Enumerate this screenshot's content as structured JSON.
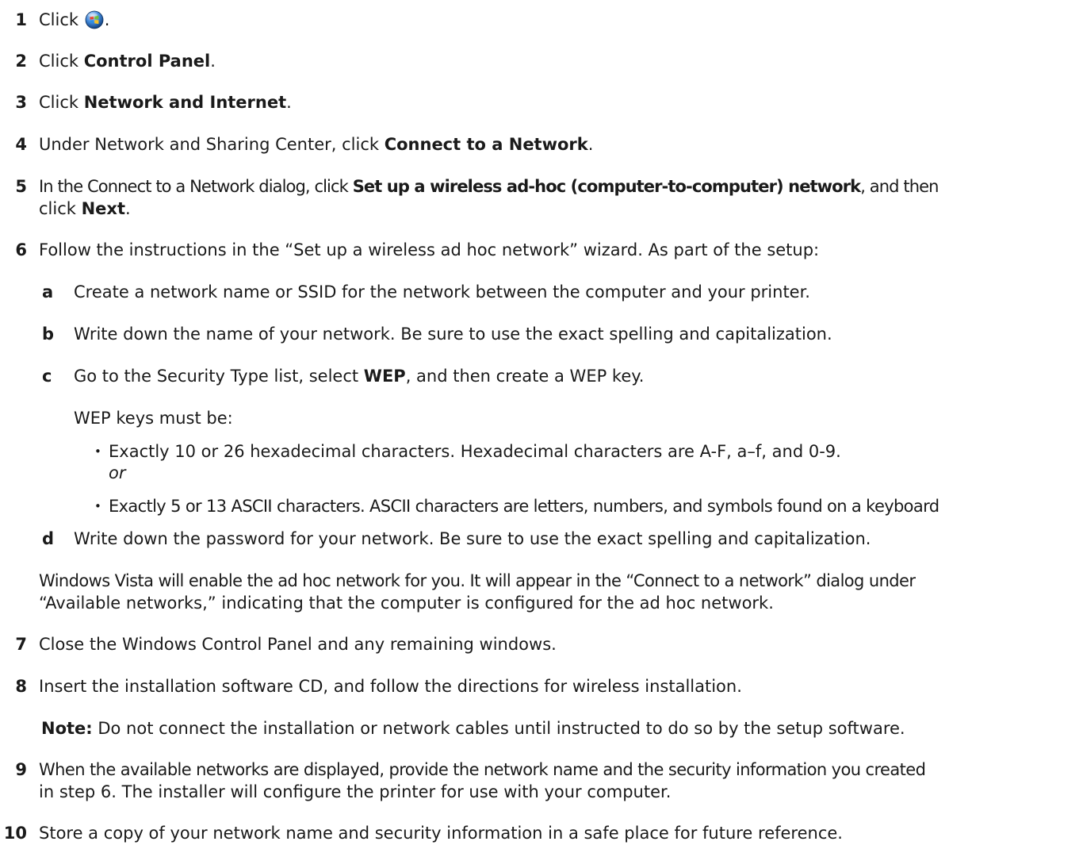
{
  "steps": {
    "s1": {
      "num": "1",
      "text": "Click",
      "end": "."
    },
    "s2": {
      "num": "2",
      "pre": "Click ",
      "bold": "Control Panel",
      "end": "."
    },
    "s3": {
      "num": "3",
      "pre": "Click ",
      "bold": "Network and Internet",
      "end": "."
    },
    "s4": {
      "num": "4",
      "pre": "Under Network and Sharing Center, click ",
      "bold": "Connect to a Network",
      "end": "."
    },
    "s5": {
      "num": "5",
      "pre": "In the Connect to a Network dialog, click ",
      "bold": "Set up a wireless ad-hoc (computer-to-computer) network",
      "mid": ", and then",
      "line2_pre": "click ",
      "line2_bold": "Next",
      "end": "."
    },
    "s6": {
      "num": "6",
      "text": "Follow the instructions in the “Set up a wireless ad hoc network” wizard. As part of the setup:"
    },
    "s6a": {
      "letter": "a",
      "text": "Create a network name or SSID for the network between the computer and your printer."
    },
    "s6b": {
      "letter": "b",
      "text": "Write down the name of your network. Be sure to use the exact spelling and capitalization."
    },
    "s6c": {
      "letter": "c",
      "pre": "Go to the Security Type list, select ",
      "bold": "WEP",
      "end": ", and then create a WEP key."
    },
    "wep_intro": "WEP keys must be:",
    "bullet1": "Exactly 10 or 26 hexadecimal characters. Hexadecimal characters are A-F, a–f, and 0-9.",
    "or": "or",
    "bullet2": "Exactly 5 or 13 ASCII characters. ASCII characters are letters, numbers, and symbols found on a keyboard",
    "s6d": {
      "letter": "d",
      "text": "Write down the password for your network. Be sure to use the exact spelling and capitalization."
    },
    "vista_note_1": "Windows Vista will enable the ad hoc network for you. It will appear in the “Connect to a network” dialog under",
    "vista_note_2": "“Available networks,” indicating that the computer is configured for the ad hoc network.",
    "s7": {
      "num": "7",
      "text": "Close the Windows Control Panel and any remaining windows."
    },
    "s8": {
      "num": "8",
      "text": "Insert the installation software CD, and follow the directions for wireless installation."
    },
    "note": {
      "label": "Note:",
      "text": " Do not connect the installation or network cables until instructed to do so by the setup software."
    },
    "s9": {
      "num": "9",
      "line1": "When the available networks are displayed, provide the network name and the security information you created",
      "line2": "in step 6. The installer will configure the printer for use with your computer."
    },
    "s10": {
      "num": "10",
      "text": "Store a copy of your network name and security information in a safe place for future reference."
    }
  },
  "icons": {
    "start": "windows-start-orb-icon",
    "bullet": "•"
  }
}
